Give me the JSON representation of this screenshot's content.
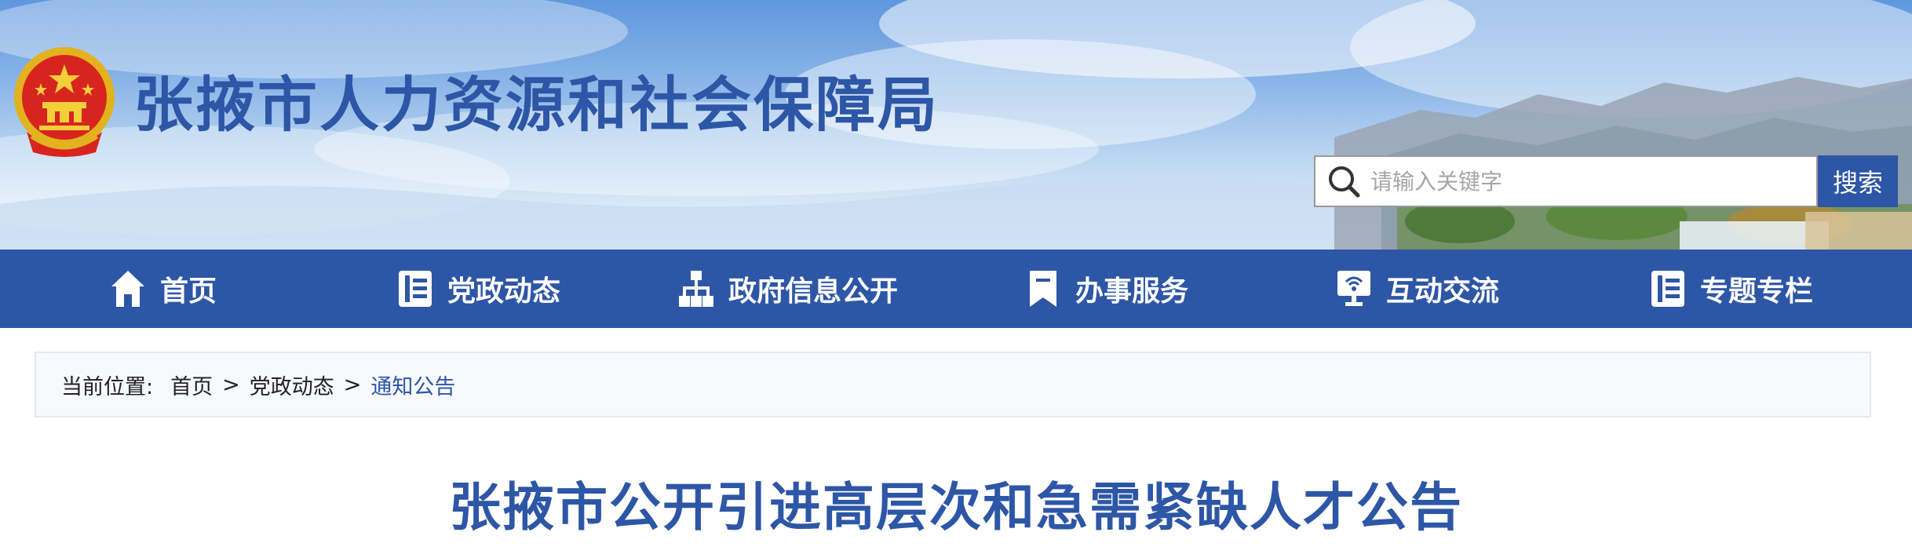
{
  "header": {
    "site_title": "张掖市人力资源和社会保障局",
    "search_placeholder": "请输入关键字",
    "search_button": "搜索"
  },
  "nav": [
    {
      "label": "首页",
      "icon": "home-icon"
    },
    {
      "label": "党政动态",
      "icon": "document-icon"
    },
    {
      "label": "政府信息公开",
      "icon": "org-chart-icon"
    },
    {
      "label": "办事服务",
      "icon": "bookmark-icon"
    },
    {
      "label": "互动交流",
      "icon": "monitor-signal-icon"
    },
    {
      "label": "专题专栏",
      "icon": "document-icon"
    }
  ],
  "breadcrumb": {
    "label": "当前位置:",
    "items": [
      "首页",
      "党政动态",
      "通知公告"
    ],
    "separator": ">"
  },
  "article": {
    "title": "张掖市公开引进高层次和急需紧缺人才公告"
  },
  "colors": {
    "brand_blue": "#2d56a6",
    "banner_sky": "#86b2e6",
    "breadcrumb_bg": "#f7f9fd"
  }
}
